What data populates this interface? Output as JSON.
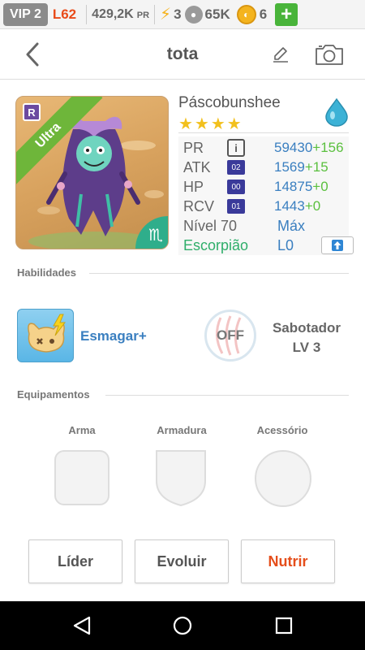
{
  "statusbar": {
    "vip": "VIP 2",
    "level": "L62",
    "power": "429,2K",
    "power_unit": "PR",
    "energy": "3",
    "food": "65K",
    "coins": "6",
    "plus": "+"
  },
  "header": {
    "title": "tota"
  },
  "monster": {
    "ribbon": "Ultra",
    "rarity_badge": "R",
    "name": "Páscobunshee",
    "stars": "★★★★",
    "element_icon": "water-drop-icon",
    "zodiac_symbol": "♏",
    "stats": {
      "pr_label": "PR",
      "pr_value": "59430",
      "pr_bonus": "+156",
      "atk_label": "ATK",
      "atk_tag": "02",
      "atk_value": "1569",
      "atk_bonus": "+15",
      "hp_label": "HP",
      "hp_tag": "00",
      "hp_value": "14875",
      "hp_bonus": "+0",
      "rcv_label": "RCV",
      "rcv_tag": "01",
      "rcv_value": "1443",
      "rcv_bonus": "+0",
      "level_label": "Nível 70",
      "level_value": "Máx",
      "zodiac_label": "Escorpião",
      "zodiac_value": "L0"
    }
  },
  "skills": {
    "section_title": "Habilidades",
    "skill_name": "Esmagar+",
    "passive_state": "OFF",
    "passive_name": "Sabotador",
    "passive_level": "LV 3"
  },
  "equipment": {
    "section_title": "Equipamentos",
    "slots": [
      "Arma",
      "Armadura",
      "Acessório"
    ]
  },
  "actions": {
    "leader": "Líder",
    "evolve": "Evoluir",
    "feed": "Nutrir"
  },
  "colors": {
    "accent_orange": "#e54e1b",
    "stat_blue": "#3a7fc0",
    "bonus_green": "#5bc03f",
    "ribbon_green": "#6eb63a"
  }
}
